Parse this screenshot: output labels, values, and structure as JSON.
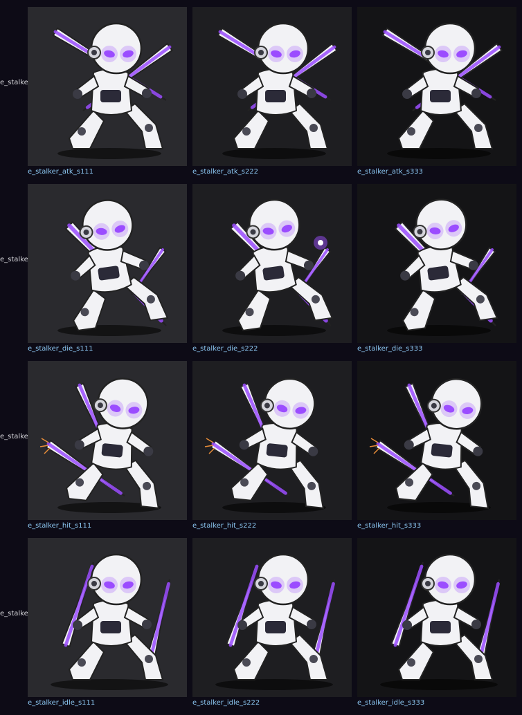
{
  "rows": [
    {
      "label": "e_stalker",
      "cells": [
        {
          "caption": "e_stalker_atk_s111",
          "bg": "#2a2a2e",
          "pose": "atk"
        },
        {
          "caption": "e_stalker_atk_s222",
          "bg": "#1e1e21",
          "pose": "atk"
        },
        {
          "caption": "e_stalker_atk_s333",
          "bg": "#141416",
          "pose": "atk"
        }
      ]
    },
    {
      "label": "e_stalker",
      "cells": [
        {
          "caption": "e_stalker_die_s111",
          "bg": "#2a2a2e",
          "pose": "die"
        },
        {
          "caption": "e_stalker_die_s222",
          "bg": "#1e1e21",
          "pose": "die"
        },
        {
          "caption": "e_stalker_die_s333",
          "bg": "#141416",
          "pose": "die"
        }
      ]
    },
    {
      "label": "e_stalker",
      "cells": [
        {
          "caption": "e_stalker_hit_s111",
          "bg": "#2a2a2e",
          "pose": "hit"
        },
        {
          "caption": "e_stalker_hit_s222",
          "bg": "#1e1e21",
          "pose": "hit"
        },
        {
          "caption": "e_stalker_hit_s333",
          "bg": "#141416",
          "pose": "hit"
        }
      ]
    },
    {
      "label": "e_stalker",
      "cells": [
        {
          "caption": "e_stalker_idle_s111",
          "bg": "#2a2a2e",
          "pose": "idle"
        },
        {
          "caption": "e_stalker_idle_s222",
          "bg": "#1e1e21",
          "pose": "idle"
        },
        {
          "caption": "e_stalker_idle_s333",
          "bg": "#141416",
          "pose": "idle"
        }
      ]
    }
  ],
  "colors": {
    "page_bg": "#0d0b16",
    "caption": "#8cc7f2",
    "row_label": "#d9d9de",
    "accent_glow": "#9b4dff",
    "robot_white": "#f2f2f5"
  },
  "icons": {
    "sprite": "robot-swordsman-sprite"
  }
}
